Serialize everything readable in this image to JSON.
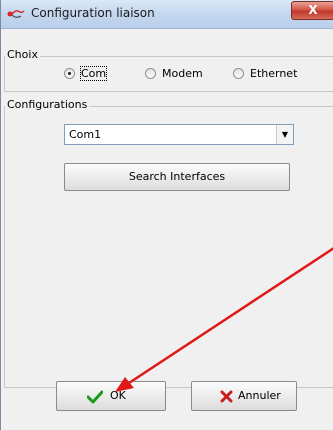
{
  "window": {
    "title": "Configuration liaison",
    "close_label": "X"
  },
  "choix": {
    "label": "Choix",
    "options": [
      {
        "label": "Com",
        "selected": true
      },
      {
        "label": "Modem",
        "selected": false
      },
      {
        "label": "Ethernet",
        "selected": false
      }
    ]
  },
  "configurations": {
    "label": "Configurations",
    "selected_value": "Com1",
    "search_label": "Search Interfaces"
  },
  "buttons": {
    "ok_label": "OK",
    "cancel_label": "Annuler"
  },
  "colors": {
    "ok_check": "#1a9a1a",
    "cancel_x": "#c81e1e",
    "annotation_arrow": "#e01818"
  },
  "icons": {
    "app": "app-icon",
    "ok": "checkmark-icon",
    "cancel": "cross-icon"
  }
}
